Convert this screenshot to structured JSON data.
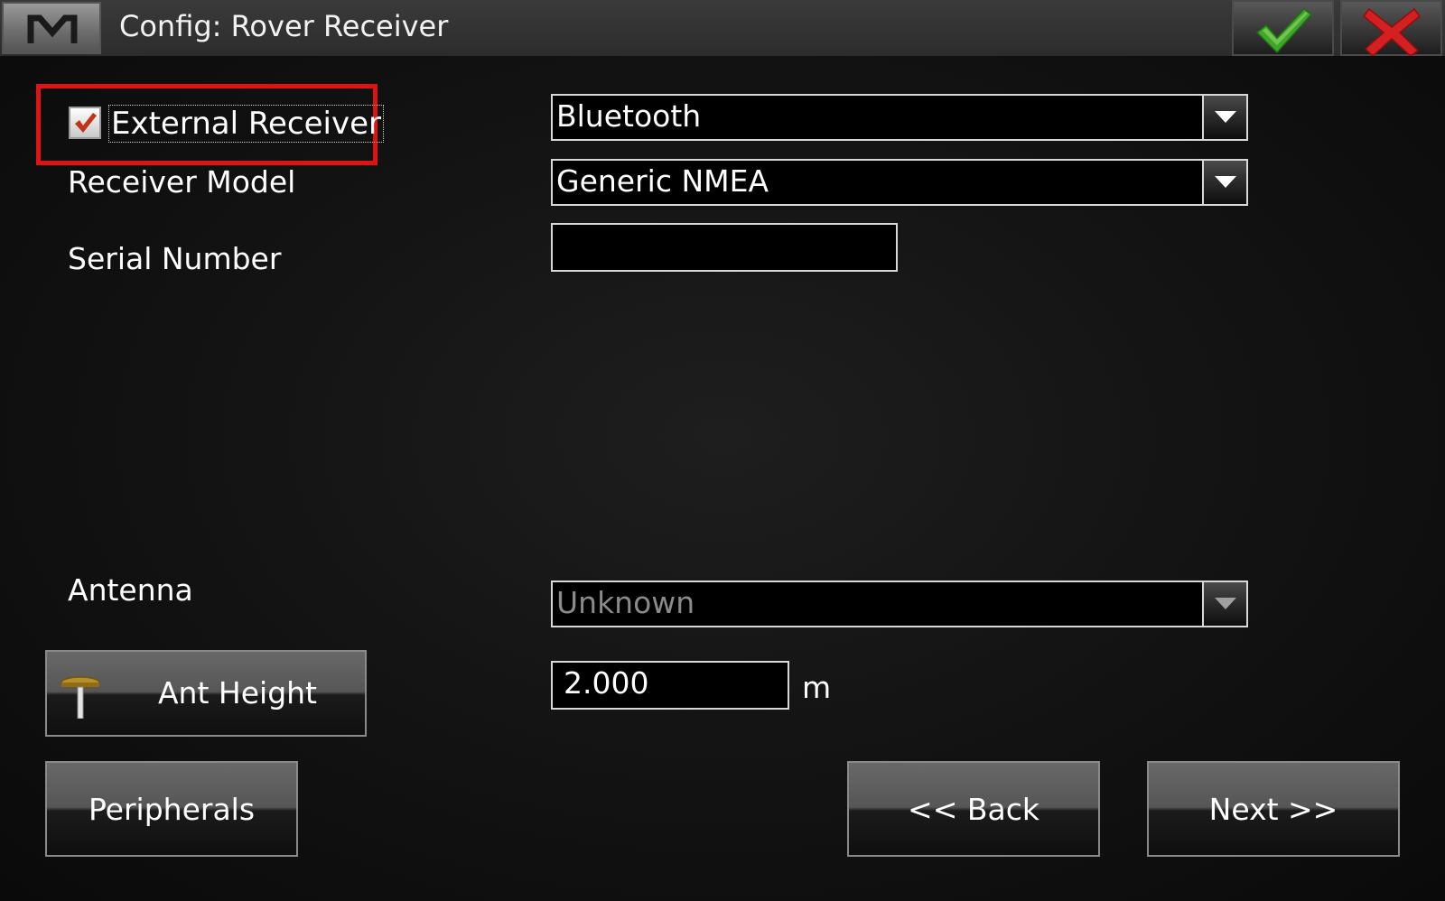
{
  "window": {
    "title": "Config: Rover Receiver",
    "menu_icon": "m-logo-icon",
    "ok_icon": "green-checkmark-icon",
    "cancel_icon": "red-x-icon"
  },
  "form": {
    "external_receiver": {
      "label": "External Receiver",
      "checked": true,
      "highlight_color": "#e01313"
    },
    "connection": {
      "value": "Bluetooth"
    },
    "receiver_model": {
      "label": "Receiver Model",
      "value": "Generic NMEA"
    },
    "serial_number": {
      "label": "Serial Number",
      "value": ""
    },
    "antenna": {
      "label": "Antenna",
      "value": "Unknown",
      "disabled": true
    },
    "ant_height": {
      "button_label": "Ant Height",
      "icon": "antenna-pole-icon",
      "value": "2.000",
      "unit": "m"
    }
  },
  "buttons": {
    "peripherals": "Peripherals",
    "back": "<< Back",
    "next": "Next >>"
  }
}
